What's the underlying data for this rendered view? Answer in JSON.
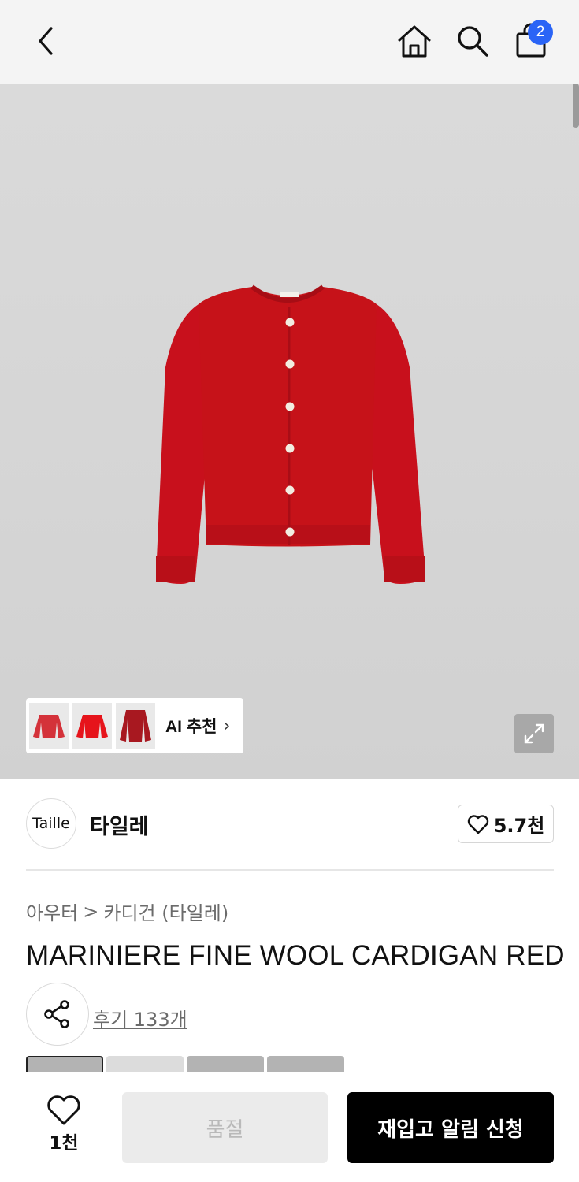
{
  "header": {
    "back_icon": "chevron-left-icon",
    "home_icon": "home-icon",
    "search_icon": "search-icon",
    "cart_icon": "shopping-bag-icon",
    "cart_badge": "2",
    "badge_color": "#2a64f6"
  },
  "hero": {
    "product_color": "#c8101c",
    "ai_recommend": {
      "label": "AI 추천",
      "chevron": "›",
      "thumbnails": [
        "thumb-red-cardigan-1",
        "thumb-red-cardigan-2",
        "thumb-red-cardigan-3"
      ]
    },
    "expand_icon": "expand-icon"
  },
  "brand": {
    "logo_text": "Taille",
    "name": "타일레",
    "likes": "5.7천"
  },
  "breadcrumb": {
    "category": "아우터",
    "separator": ">",
    "subcategory": "카디건 (타일레)"
  },
  "product": {
    "title": "MARINIERE FINE WOOL CARDIGAN RED",
    "reviews": "후기 133개"
  },
  "bottom_bar": {
    "wish_count": "1천",
    "soldout_label": "품절",
    "restock_label": "재입고 알림 신청"
  }
}
